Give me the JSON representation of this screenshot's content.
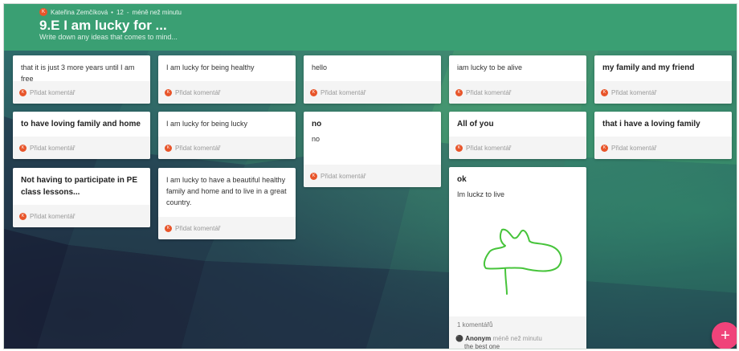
{
  "header": {
    "author": "Kateřina Zemčíková",
    "author_initial": "K",
    "likes": "12",
    "separator": "•",
    "dash": "-",
    "time": "méně než minutu",
    "title": "9.E I am lucky for ...",
    "description": "Write down any ideas that comes to mind..."
  },
  "posts": [
    {
      "text": "that it is just 3 more years until I am free",
      "comment_label": "Přidat komentář",
      "initial": "K"
    },
    {
      "text": "I am lucky for being healthy",
      "comment_label": "Přidat komentář",
      "initial": "K"
    },
    {
      "text": "hello",
      "comment_label": "Přidat komentář",
      "initial": "K"
    },
    {
      "text": "iam lucky to be alive",
      "comment_label": "Přidat komentář",
      "initial": "K"
    },
    {
      "title": "my family and my friend",
      "comment_label": "Přidat komentář",
      "initial": "K"
    },
    {
      "title": "to have loving family and home",
      "comment_label": "Přidat komentář",
      "initial": "K"
    },
    {
      "text": "I am lucky for being lucky",
      "comment_label": "Přidat komentář",
      "initial": "K"
    },
    {
      "title": "no",
      "text": "no",
      "comment_label": "Přidat komentář",
      "initial": "K"
    },
    {
      "title": "All of you",
      "comment_label": "Přidat komentář",
      "initial": "K"
    },
    {
      "title": "that i have a loving family",
      "comment_label": "Přidat komentář",
      "initial": "K"
    },
    {
      "title": "Not having to participate in PE class lessons...",
      "comment_label": "Přidat komentář",
      "initial": "K"
    },
    {
      "text": "I am lucky to have a beautiful healthy family and home and to live in a great country.",
      "comment_label": "Přidat komentář",
      "initial": "K"
    },
    {
      "title": "ok",
      "text": "Im luckz to live",
      "comments_count": "1 komentářů",
      "comment": {
        "author": "Anonym",
        "time": "méně než minutu",
        "text": "the best one"
      }
    }
  ],
  "fab_label": "+",
  "colors": {
    "header": "#3a9f73",
    "fab": "#f0437a",
    "avatar": "#e8552a",
    "drawing": "#47c43b"
  }
}
